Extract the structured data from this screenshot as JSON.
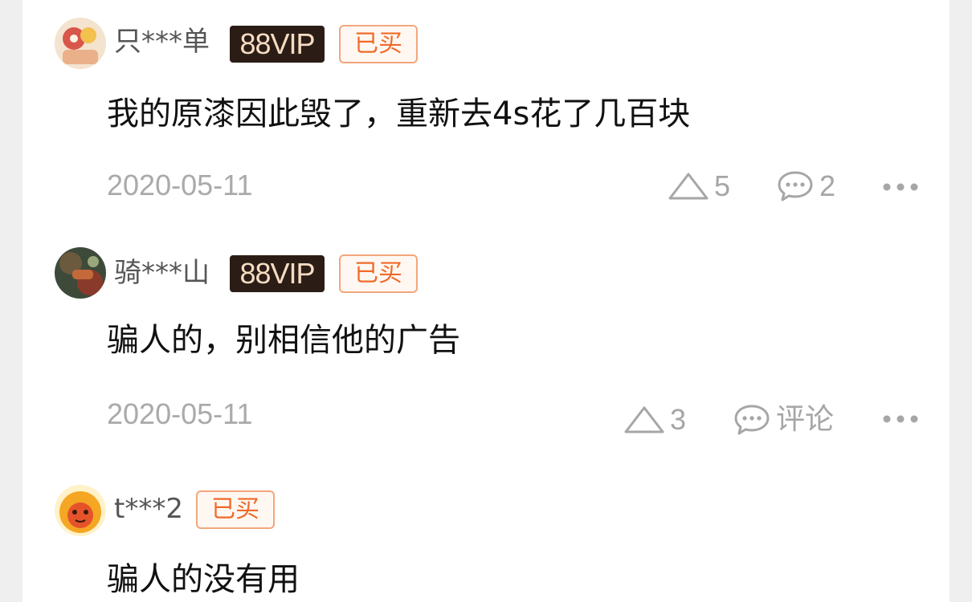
{
  "reviews": [
    {
      "username": "只***单",
      "vip_label": "88VIP",
      "bought_label": "已买",
      "content": "我的原漆因此毁了，重新去4s花了几百块",
      "date": "2020-05-11",
      "like_count": "5",
      "comment_label": "2"
    },
    {
      "username": "骑***山",
      "vip_label": "88VIP",
      "bought_label": "已买",
      "content": "骗人的，别相信他的广告",
      "date": "2020-05-11",
      "like_count": "3",
      "comment_label": "评论"
    },
    {
      "username": "t***2",
      "bought_label": "已买",
      "content": "骗人的没有用"
    }
  ],
  "icons": {
    "like": "triangle-up-icon",
    "comment": "chat-bubble-icon",
    "more": "more-dots-icon"
  },
  "colors": {
    "vip_bg": "#2b1d16",
    "vip_text": "#f6dcc2",
    "bought_border": "#f3a67d",
    "bought_text": "#f06a2a",
    "meta_gray": "#a6a6a6"
  }
}
